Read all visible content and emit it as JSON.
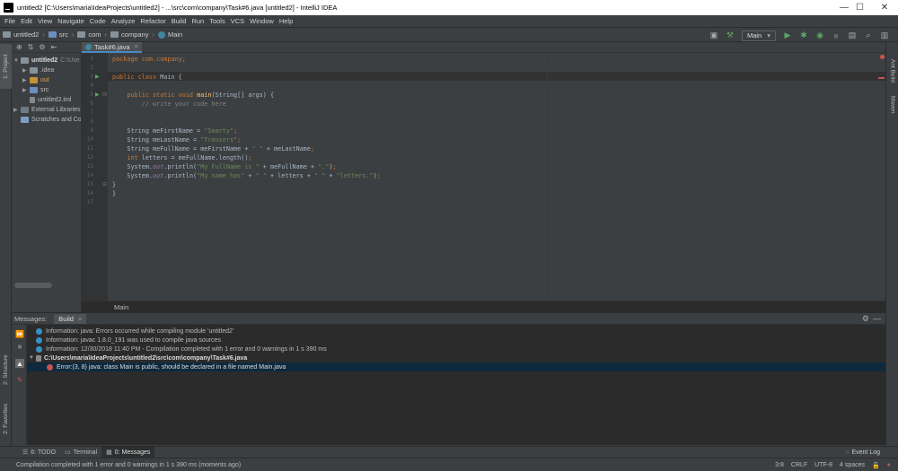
{
  "window": {
    "title": "untitled2 [C:\\Users\\maria\\IdeaProjects\\untitled2] - ...\\src\\com\\company\\Task#6.java [untitled2] - IntelliJ IDEA",
    "minimize": "—",
    "maximize": "☐",
    "close": "✕"
  },
  "menu": [
    "File",
    "Edit",
    "View",
    "Navigate",
    "Code",
    "Analyze",
    "Refactor",
    "Build",
    "Run",
    "Tools",
    "VCS",
    "Window",
    "Help"
  ],
  "breadcrumb": [
    "untitled2",
    "src",
    "com",
    "company",
    "Main"
  ],
  "run_config": "Main",
  "left_strip": {
    "project": "1: Project",
    "structure": "2: Structure",
    "favorites": "2: Favorites"
  },
  "right_strip": {
    "ant": "Ant Build",
    "maven": "Maven"
  },
  "project_tree": {
    "root": {
      "name": "untitled2",
      "path": "C:\\Use"
    },
    "items": [
      ".idea",
      "out",
      "src",
      "untitled2.iml"
    ],
    "external": "External Libraries",
    "scratches": "Scratches and Co"
  },
  "editor": {
    "tab": "Task#6.java",
    "tab_close": "×",
    "line_numbers": [
      "1",
      "2",
      "3",
      "4",
      "5",
      "6",
      "7",
      "8",
      "9",
      "10",
      "11",
      "12",
      "13",
      "14",
      "15",
      "16",
      "17"
    ],
    "lines": [
      "package com.company;",
      "",
      "public class Main {",
      "",
      "    public static void main(String[] args) {",
      "        // write your code here",
      "",
      "",
      "    String meFirstName = \"Smarty\";",
      "    String meLastName = \"Trousers\";",
      "    String meFullName = meFirstName + \" \" + meLastName;",
      "    int letters = meFullName.length();",
      "    System.out.println(\"My FullName is \" + meFullName + \".\");",
      "    System.out.println(\"My name has\" + \" \" + letters + \" \" + \"letters.\");",
      "}",
      "}",
      ""
    ],
    "breadcrumb": "Main"
  },
  "messages": {
    "header_label": "Messages:",
    "tab": "Build",
    "tab_close": "×",
    "rows": [
      {
        "type": "info",
        "text": "Information: java: Errors occurred while compiling module 'untitled2'"
      },
      {
        "type": "info",
        "text": "Information: javac 1.8.0_191 was used to compile java sources"
      },
      {
        "type": "info",
        "text": "Information: 12/30/2018 11:40 PM - Compilation completed with 1 error and 0 warnings in 1 s 390 ms"
      },
      {
        "type": "file",
        "text": "C:\\Users\\maria\\IdeaProjects\\untitled2\\src\\com\\company\\Task#6.java"
      },
      {
        "type": "error",
        "text": "Error:(3, 8)  java: class Main is public, should be declared in a file named Main.java"
      }
    ]
  },
  "bottom_tabs": [
    "6: TODO",
    "Terminal",
    "0: Messages"
  ],
  "event_log": "Event Log",
  "status": {
    "message": "Compilation completed with 1 error and 0 warnings in 1 s 390 ms (moments ago)",
    "position": "3:8",
    "line_sep": "CRLF",
    "encoding": "UTF-8",
    "indent": "4 spaces"
  },
  "colors": {
    "keyword": "#cc7832",
    "string": "#6a8759",
    "comment": "#808080",
    "function": "#ffc66d",
    "selection": "#0d293e",
    "error": "#c75450",
    "info": "#3592c4"
  }
}
